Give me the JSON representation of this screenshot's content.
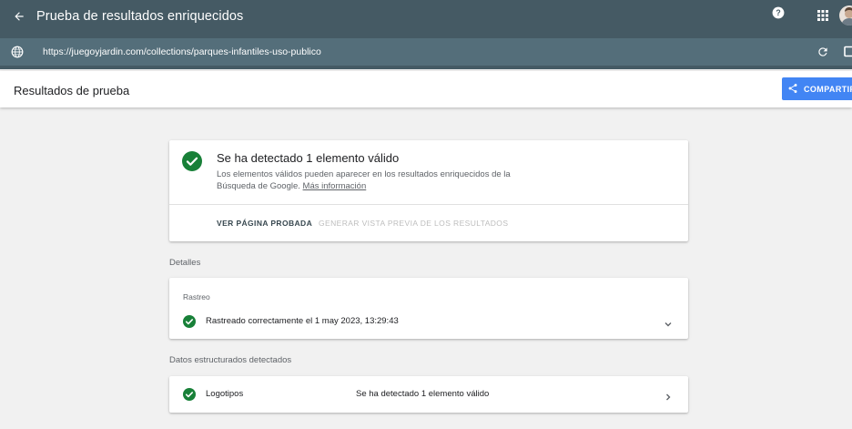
{
  "app": {
    "title": "Prueba de resultados enriquecidos",
    "icons": {
      "back": "arrow-left-icon",
      "help": "help-icon",
      "apps": "apps-grid-icon",
      "avatar": "avatar"
    }
  },
  "urlbar": {
    "url": "https://juegoyjardin.com/collections/parques-infantiles-uso-publico",
    "icons": {
      "globe": "globe-icon",
      "refresh": "refresh-icon",
      "device": "device-icon"
    }
  },
  "subheader": {
    "title": "Resultados de prueba",
    "share_label": "COMPARTIR"
  },
  "summary": {
    "heading": "Se ha detectado 1 elemento válido",
    "description": "Los elementos válidos pueden aparecer en los resultados enriquecidos de la Búsqueda de Google.",
    "more_info": "Más información",
    "action_view": "VER PÁGINA PROBADA",
    "action_preview": "GENERAR VISTA PREVIA DE LOS RESULTADOS"
  },
  "details": {
    "section_label": "Detalles",
    "card_label": "Rastreo",
    "crawl_status": "Rastreado correctamente el 1 may 2023, 13:29:43"
  },
  "structured": {
    "section_label": "Datos estructurados detectados",
    "items": [
      {
        "name": "Logotipos",
        "status": "Se ha detectado 1 elemento válido"
      }
    ]
  },
  "colors": {
    "appbar": "#455a64",
    "urlbar": "#546e7a",
    "success": "#188038",
    "accent": "#4285f4"
  }
}
